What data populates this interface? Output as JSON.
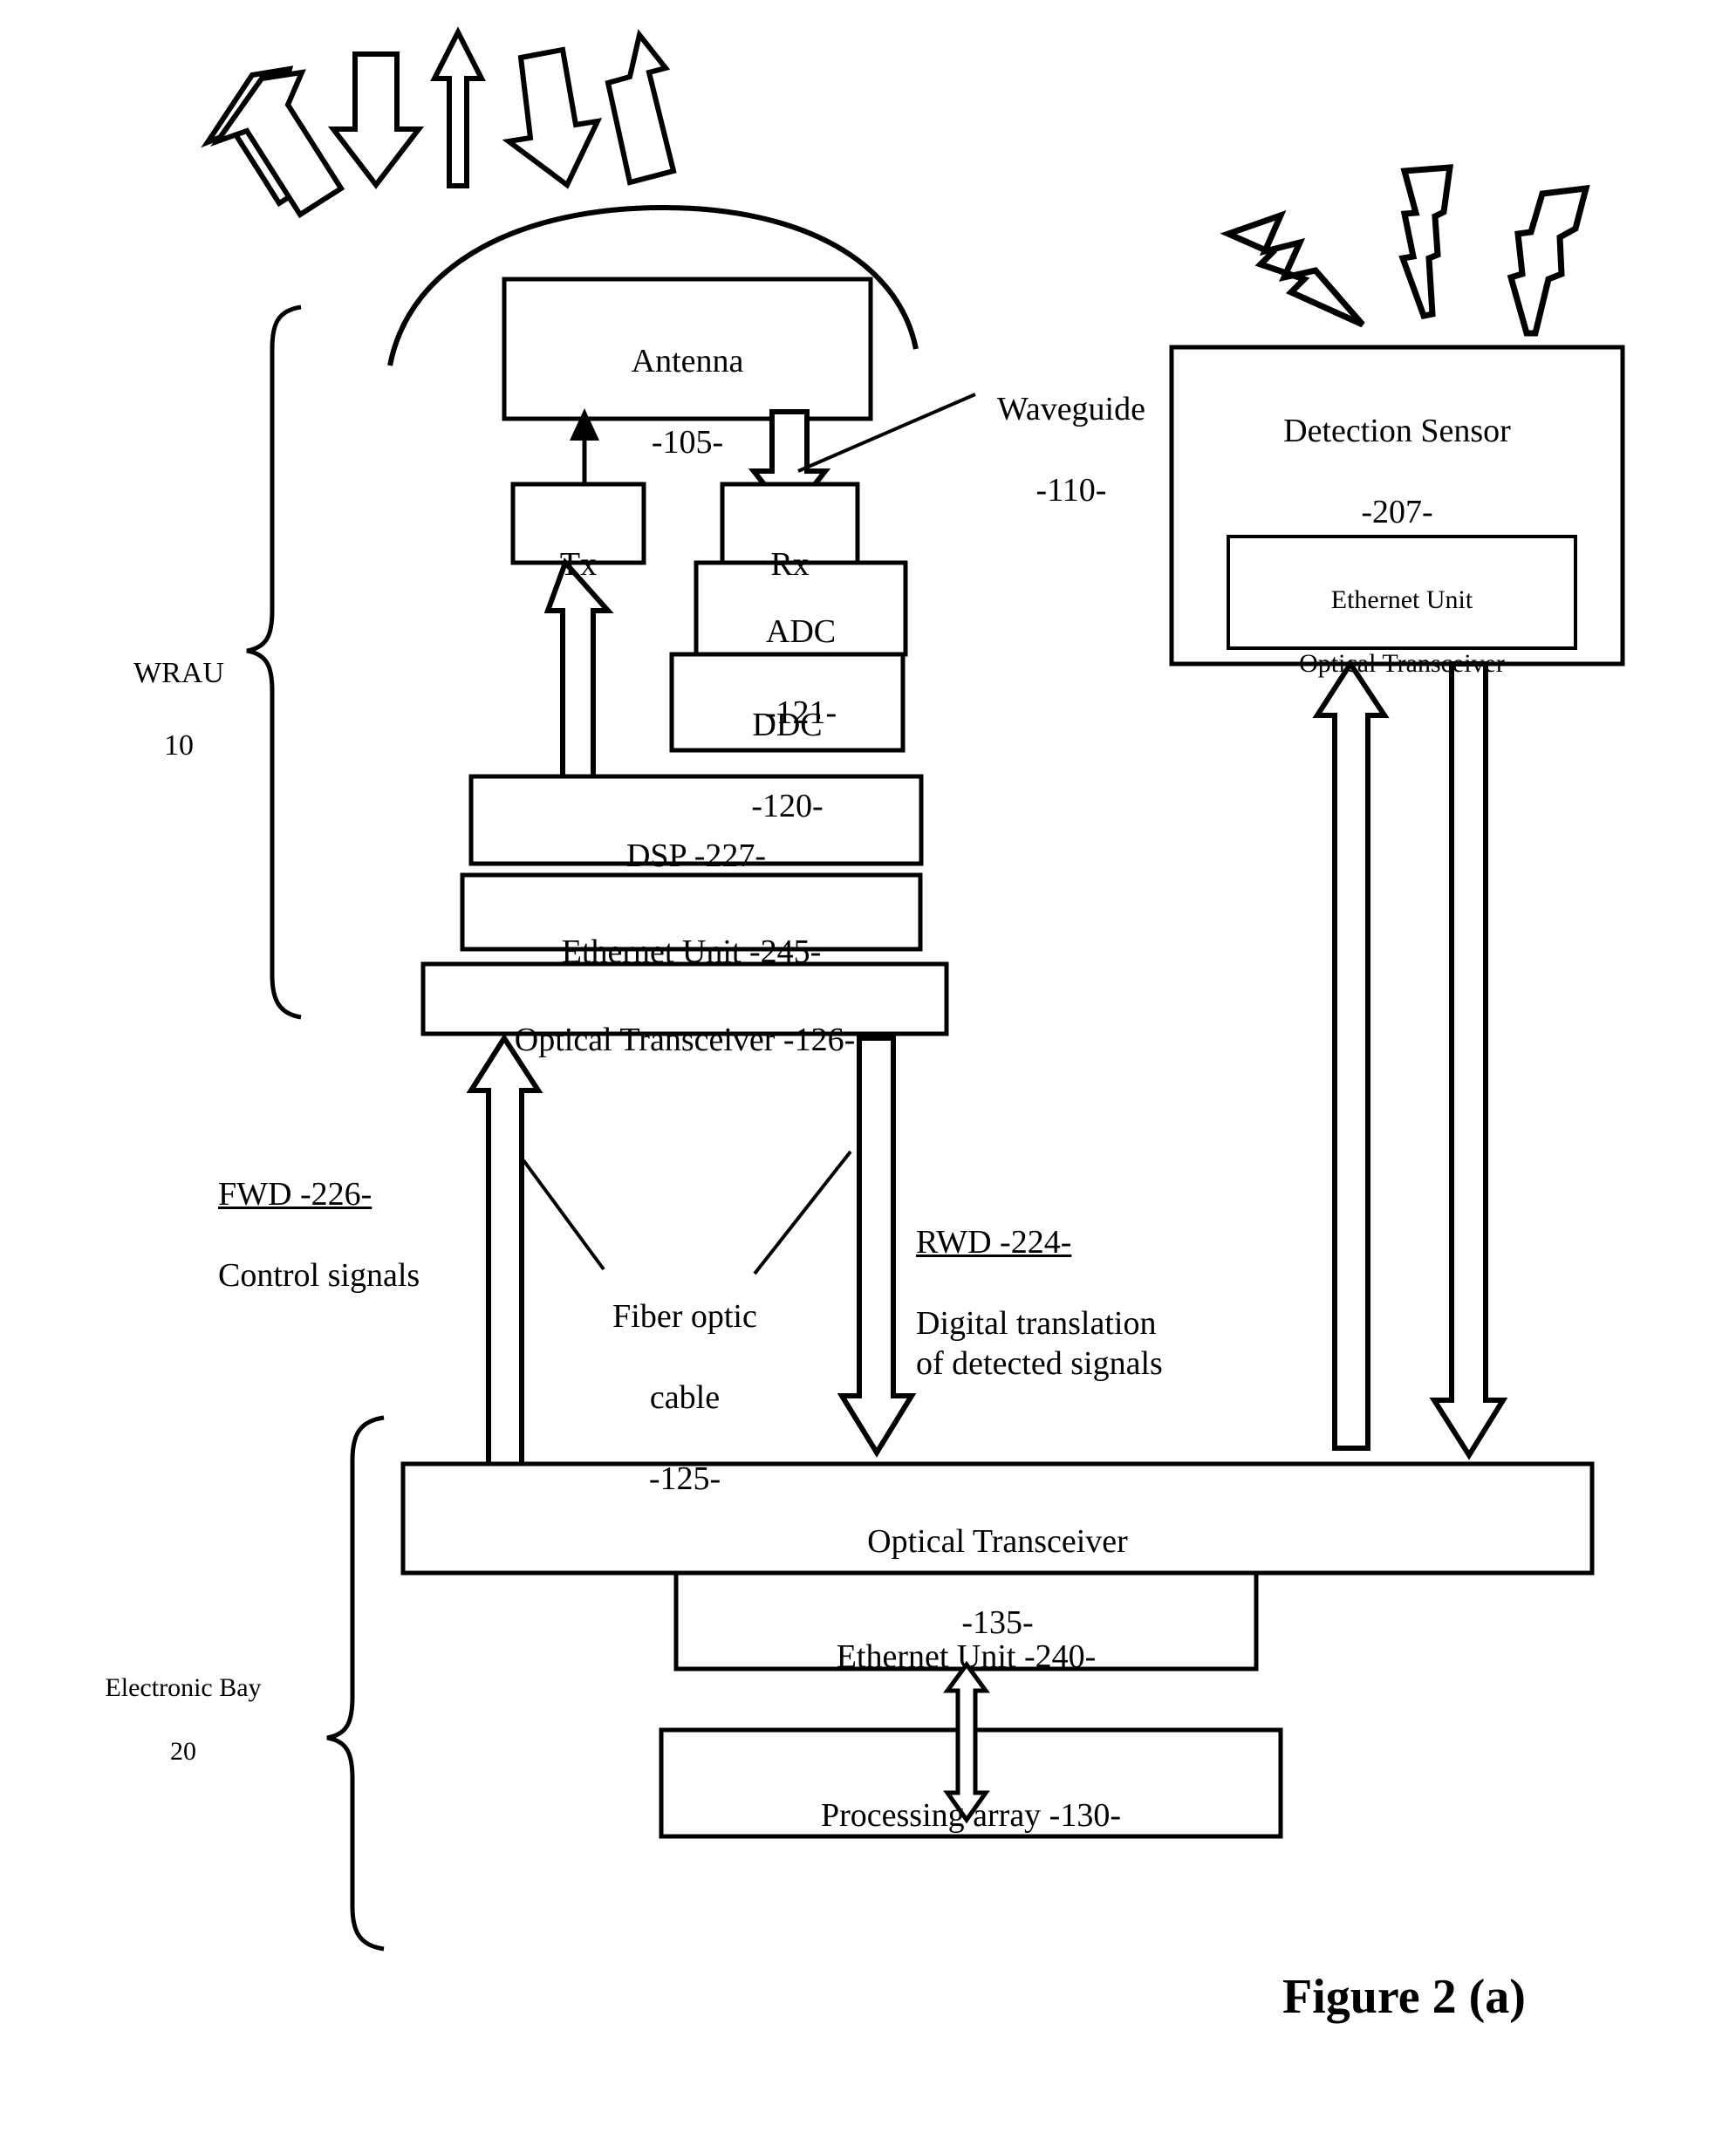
{
  "figure": {
    "caption": "Figure 2 (a)"
  },
  "blocks": {
    "antenna": {
      "line1": "Antenna",
      "line2": "-105-"
    },
    "tx": {
      "line1": "Tx"
    },
    "rx": {
      "line1": "Rx"
    },
    "adc": {
      "line1": "ADC",
      "line2": "-121-"
    },
    "ddc": {
      "line1": "DDC",
      "line2": "-120-"
    },
    "dsp": {
      "line1": "DSP -227-"
    },
    "ethernet_unit_245": {
      "line1": "Ethernet Unit -245-"
    },
    "optical_transceiver_126": {
      "line1": "Optical Transceiver -126-"
    },
    "detection_sensor": {
      "line1": "Detection Sensor",
      "line2": "-207-"
    },
    "sensor_ethernet_optical": {
      "line1": "Ethernet Unit",
      "line2": "Optical Transceiver"
    },
    "optical_transceiver_135": {
      "line1": "Optical Transceiver",
      "line2": "-135-"
    },
    "ethernet_unit_240": {
      "line1": "Ethernet Unit  -240-"
    },
    "processing_array_130": {
      "line1": "Processing array -130-"
    }
  },
  "annotations": {
    "waveguide": {
      "line1": "Waveguide",
      "line2": "-110-"
    },
    "wrau": {
      "line1": "WRAU",
      "line2": "10"
    },
    "electronic_bay": {
      "line1": "Electronic Bay",
      "line2": "20"
    },
    "fwd": {
      "title": "FWD -226-",
      "body": "Control signals"
    },
    "rwd": {
      "title": "RWD  -224-",
      "body": "Digital translation\nof detected signals"
    },
    "fiber_optic_cable": {
      "line1": "Fiber optic",
      "line2": "cable",
      "line3": "-125-"
    }
  },
  "icons": {
    "radiation_arrows": "rf-beam-arrows-icon",
    "lightning_bolts": "lightning-bolt-icon",
    "fiber_arrows": "fiber-link-arrow-icon",
    "bracket_wrau": "brace-bracket-icon",
    "bracket_bay": "brace-bracket-icon"
  },
  "colors": {
    "stroke": "#000000",
    "fill": "#ffffff",
    "background": "#ffffff"
  }
}
